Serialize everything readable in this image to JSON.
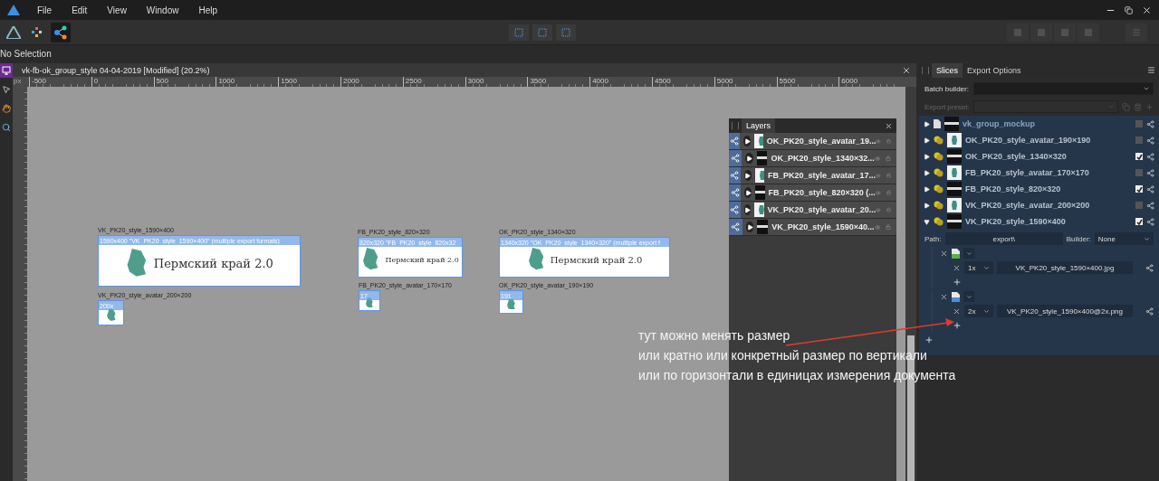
{
  "app_menu": [
    "File",
    "Edit",
    "View",
    "Window",
    "Help"
  ],
  "personas": [
    {
      "kind": "designer",
      "selected": false
    },
    {
      "kind": "pixel",
      "selected": false
    },
    {
      "kind": "export",
      "selected": true
    }
  ],
  "context_toolbar": {
    "status": "No Selection"
  },
  "tools": [
    {
      "kind": "slice",
      "selected": true
    },
    {
      "kind": "move",
      "selected": false
    },
    {
      "kind": "hand",
      "selected": false
    },
    {
      "kind": "zoom",
      "selected": false
    }
  ],
  "document": {
    "title": "vk-fb-ok_group_style 04-04-2019 [Modified] (20.2%)",
    "ruler_unit": "px",
    "ruler_ticks": [
      "-500",
      "0",
      "500",
      "1000",
      "1500",
      "2000",
      "2500",
      "3000",
      "3500",
      "4000",
      "4500",
      "5000",
      "5500",
      "6000"
    ]
  },
  "artboards": [
    {
      "kind": "banner",
      "label": "VK_PK20_style_1590×400",
      "header": "1590x400 \"VK_PK20_style_1590×400\" (multiple export formats)",
      "banner_title": "Пермский край 2.0"
    },
    {
      "kind": "avatar",
      "label": "VK_PK20_style_avatar_200×200",
      "header": "200x"
    },
    {
      "kind": "banner",
      "label": "FB_PK20_style_820×320",
      "header": "820x320 \"FB_PK20_style_820x32",
      "banner_title": "Пермский край 2.0"
    },
    {
      "kind": "avatar",
      "label": "FB_PK20_style_avatar_170×170",
      "header": "17"
    },
    {
      "kind": "banner",
      "label": "OK_PK20_style_1340×320",
      "header": "1340x320 \"OK_PK20_style_1340×320\" (multiple export f",
      "banner_title": "Пермский край 2.0"
    },
    {
      "kind": "avatar",
      "label": "OK_PK20_style_avatar_190×190",
      "header": "191"
    }
  ],
  "layers_panel": {
    "title": "Layers",
    "items": [
      {
        "name": "OK_PK20_style_avatar_19...",
        "kind": "avatar"
      },
      {
        "name": "OK_PK20_style_1340×32...",
        "kind": "banner"
      },
      {
        "name": "FB_PK20_style_avatar_17...",
        "kind": "avatar"
      },
      {
        "name": "FB_PK20_style_820×320 (...",
        "kind": "banner"
      },
      {
        "name": "VK_PK20_style_avatar_20...",
        "kind": "avatar"
      },
      {
        "name": "VK_PK20_style_1590×40...",
        "kind": "banner"
      }
    ]
  },
  "export_panel": {
    "tabs": [
      {
        "label": "Slices",
        "selected": true
      },
      {
        "label": "Export Options",
        "selected": false
      }
    ],
    "batch_builder_label": "Batch builder:",
    "export_preset_label": "Export preset:",
    "slices": [
      {
        "name": "vk_group_mockup",
        "kind": "document",
        "expanded": false,
        "checked": false
      },
      {
        "name": "OK_PK20_style_avatar_190×190",
        "kind": "avatar",
        "expanded": false,
        "checked": false
      },
      {
        "name": "OK_PK20_style_1340×320",
        "kind": "banner",
        "expanded": false,
        "checked": true
      },
      {
        "name": "FB_PK20_style_avatar_170×170",
        "kind": "avatar",
        "expanded": false,
        "checked": false
      },
      {
        "name": "FB_PK20_style_820×320",
        "kind": "banner",
        "expanded": false,
        "checked": true
      },
      {
        "name": "VK_PK20_style_avatar_200×200",
        "kind": "avatar",
        "expanded": false,
        "checked": false
      },
      {
        "name": "VK_PK20_style_1590×400",
        "kind": "banner",
        "expanded": true,
        "checked": true
      }
    ],
    "detail": {
      "path_label": "Path:",
      "path": "export\\",
      "builder_label": "Builder:",
      "builder": "None",
      "formats": [
        {
          "kind": "jpeg",
          "scale": "1x",
          "filename": "VK_PK20_style_1590×400.jpg"
        },
        {
          "kind": "png",
          "scale": "2x",
          "filename": "VK_PK20_style_1590×400@2x.png"
        }
      ]
    }
  },
  "annotation": {
    "lines": [
      "тут можно менять размер",
      "или кратно или конкретный размер по вертикали",
      "или по горизонтали в единицах измерения документа"
    ]
  }
}
